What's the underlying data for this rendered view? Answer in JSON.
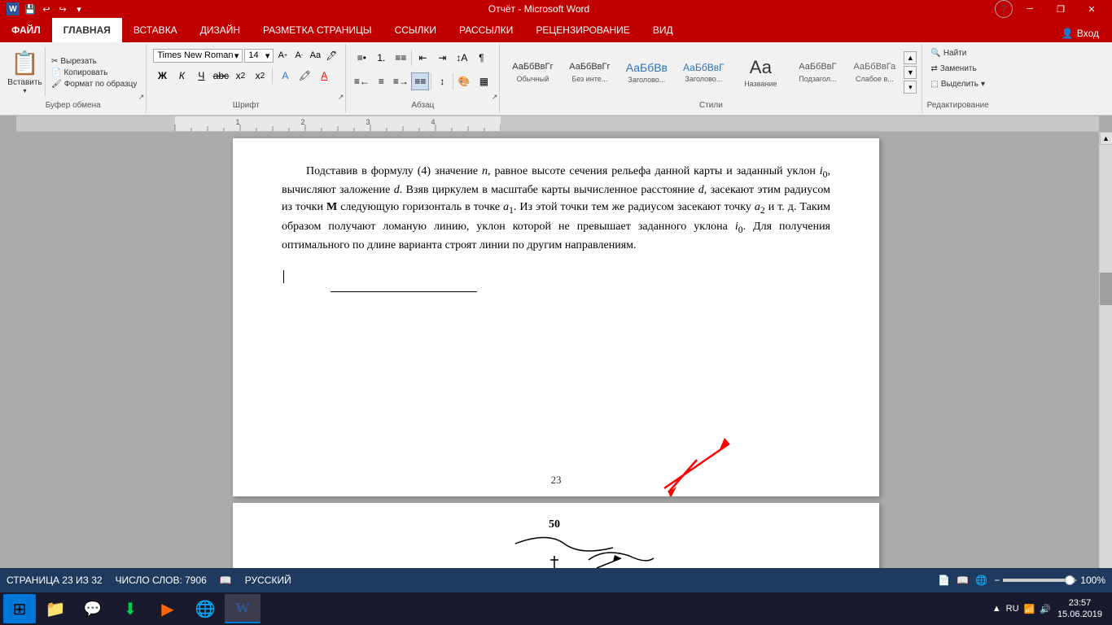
{
  "titlebar": {
    "title": "Отчёт - Microsoft Word",
    "quick_access": [
      "save",
      "undo",
      "redo"
    ],
    "window_btns": [
      "minimize",
      "restore",
      "close"
    ]
  },
  "tabs": [
    {
      "id": "file",
      "label": "ФАЙЛ",
      "active": false
    },
    {
      "id": "home",
      "label": "ГЛАВНАЯ",
      "active": true
    },
    {
      "id": "insert",
      "label": "ВСТАВКА",
      "active": false
    },
    {
      "id": "design",
      "label": "ДИЗАЙН",
      "active": false
    },
    {
      "id": "layout",
      "label": "РАЗМЕТКА СТРАНИЦЫ",
      "active": false
    },
    {
      "id": "refs",
      "label": "ССЫЛКИ",
      "active": false
    },
    {
      "id": "mailings",
      "label": "РАССЫЛКИ",
      "active": false
    },
    {
      "id": "review",
      "label": "РЕЦЕНЗИРОВАНИЕ",
      "active": false
    },
    {
      "id": "view",
      "label": "ВИД",
      "active": false
    }
  ],
  "ribbon": {
    "clipboard": {
      "label": "Буфер обмена",
      "paste": "Вставить",
      "cut": "Вырезать",
      "copy": "Копировать",
      "format_painter": "Формат по образцу"
    },
    "font": {
      "label": "Шрифт",
      "font_name": "Times New Roman",
      "font_size": "14",
      "bold": "Ж",
      "italic": "К",
      "underline": "Ч",
      "strikethrough": "abc",
      "subscript": "x₂",
      "superscript": "x²"
    },
    "paragraph": {
      "label": "Абзац"
    },
    "styles": {
      "label": "Стили",
      "items": [
        {
          "name": "Обычный",
          "preview": "АаБбВвГг"
        },
        {
          "name": "Без инте...",
          "preview": "АаБбВвГг"
        },
        {
          "name": "Заголово...",
          "preview": "АаБбВв"
        },
        {
          "name": "Заголово...",
          "preview": "АаБбВвГ"
        },
        {
          "name": "Название",
          "preview": "Аа"
        },
        {
          "name": "Подзагол...",
          "preview": "АаБбВвГ"
        },
        {
          "name": "Слабое в...",
          "preview": "АаБбВвГа"
        }
      ]
    },
    "editing": {
      "label": "Редактирование",
      "find": "Найти",
      "replace": "Заменить",
      "select": "Выделить"
    }
  },
  "login": {
    "label": "Вход"
  },
  "document": {
    "page1": {
      "text": "Подставив в формулу (4) значение n, равное высоте сечения рельефа данной карты и заданный уклон i₀, вычисляют заложение d. Взяв циркулем в масштабе карты вычисленное расстояние d, засекают этим радиусом из точки M следующую горизонталь в точке a₁. Из этой точки тем же радиусом засекают точку a₂ и т. д. Таким образом получают ломаную линию, уклон которой не превышает заданного уклона i₀. Для получения оптимального по длине варианта строят линии по другим направлениям.",
      "page_num": "23"
    },
    "page2": {
      "figure_num": "50"
    }
  },
  "statusbar": {
    "page_info": "СТРАНИЦА 23 ИЗ 32",
    "word_count": "ЧИСЛО СЛОВ: 7906",
    "language": "РУССКИЙ",
    "zoom": "100%",
    "zoom_minus": "−",
    "zoom_plus": "+"
  },
  "taskbar": {
    "time": "23:57",
    "date": "15.06.2019",
    "language": "RU",
    "apps": [
      {
        "name": "start",
        "icon": "⊞"
      },
      {
        "name": "explorer",
        "icon": "📁"
      },
      {
        "name": "discord",
        "icon": "💬"
      },
      {
        "name": "utor",
        "icon": "⬇"
      },
      {
        "name": "media",
        "icon": "▶"
      },
      {
        "name": "chrome",
        "icon": "◉"
      },
      {
        "name": "word",
        "icon": "W",
        "active": true
      }
    ]
  }
}
